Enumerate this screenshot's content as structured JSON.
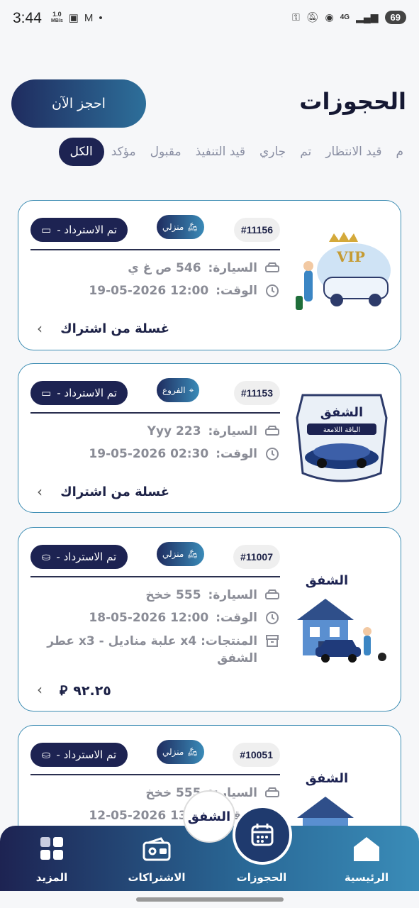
{
  "status_bar": {
    "time": "3:44",
    "speed_value": "1.0",
    "speed_unit": "MB/s",
    "network": "4G",
    "battery": "69"
  },
  "header": {
    "title": "الحجوزات",
    "book_now": "احجز الآن"
  },
  "tabs": [
    "الكل",
    "مؤكد",
    "مقبول",
    "قيد التنفيذ",
    "جاري",
    "تم",
    "قيد الانتظار",
    "م"
  ],
  "labels": {
    "car": "السيارة:",
    "time": "الوقت:",
    "products": "المنتجات:"
  },
  "cards": [
    {
      "id": "#11156",
      "type": "منزلي",
      "status": "تم الاسترداد -",
      "car": "546 ص غ ي",
      "time": "19-05-2026 12:00",
      "footer": "غسلة من اشتراك",
      "thumb_badge": "VIP"
    },
    {
      "id": "#11153",
      "type": "الفروع",
      "status": "تم الاسترداد -",
      "car": "Yyy 223",
      "time": "19-05-2026 02:30",
      "footer": "غسلة من اشتراك",
      "thumb_title": "الشفق",
      "thumb_subtitle": "الباقة اللامعة"
    },
    {
      "id": "#11007",
      "type": "منزلي",
      "status": "تم الاسترداد -",
      "car": "555 خخخ",
      "time": "18-05-2026 12:00",
      "products": "x4 علبة مناديل - x3 عطر الشفق",
      "price": "٩٢.٢٥",
      "thumb_title": "الشفق"
    },
    {
      "id": "#10051",
      "type": "منزلي",
      "status": "تم الاسترداد -",
      "car": "555 خخخ",
      "time": "12-05-2026 13:30",
      "thumb_title": "الشفق"
    }
  ],
  "bottom_nav": {
    "home": "الرئيسية",
    "bookings": "الحجوزات",
    "subscriptions": "الاشتراكات",
    "more": "المزيد",
    "logo": "الشفق"
  },
  "colors": {
    "primary": "#1d2352",
    "accent": "#3d8db3",
    "muted": "#8a8c96"
  }
}
